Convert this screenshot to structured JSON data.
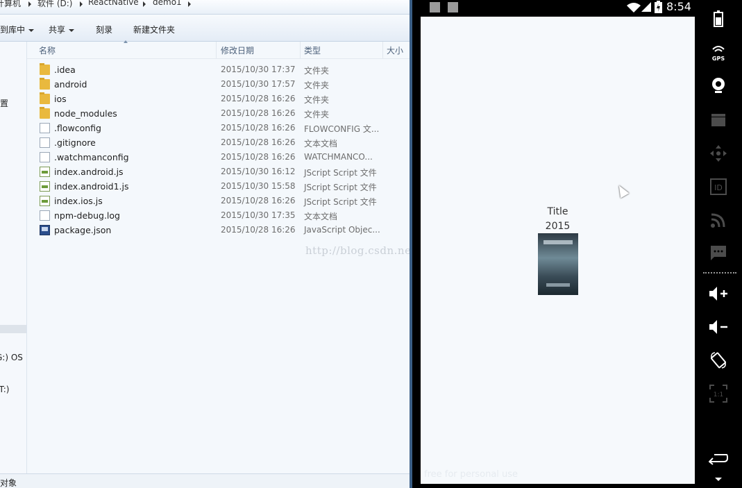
{
  "explorer": {
    "breadcrumb": [
      "计算机",
      "软件 (D:)",
      "ReactNative",
      "demo1"
    ],
    "toolbar": [
      {
        "label": "包含到库中",
        "dropdown": true
      },
      {
        "label": "共享",
        "dropdown": true
      },
      {
        "label": "刻录",
        "dropdown": false
      },
      {
        "label": "新建文件夹",
        "dropdown": false
      }
    ],
    "columns": {
      "name": "名称",
      "date": "修改日期",
      "type": "类型",
      "size": "大小"
    },
    "files": [
      {
        "name": ".idea",
        "date": "2015/10/30 17:37",
        "type": "文件夹",
        "icon": "folder"
      },
      {
        "name": "android",
        "date": "2015/10/30 17:57",
        "type": "文件夹",
        "icon": "folder"
      },
      {
        "name": "ios",
        "date": "2015/10/28 16:26",
        "type": "文件夹",
        "icon": "folder"
      },
      {
        "name": "node_modules",
        "date": "2015/10/28 16:26",
        "type": "文件夹",
        "icon": "folder"
      },
      {
        "name": ".flowconfig",
        "date": "2015/10/28 16:26",
        "type": "FLOWCONFIG 文...",
        "icon": "doc"
      },
      {
        "name": ".gitignore",
        "date": "2015/10/28 16:26",
        "type": "文本文档",
        "icon": "doc"
      },
      {
        "name": ".watchmanconfig",
        "date": "2015/10/28 16:26",
        "type": "WATCHMANCO...",
        "icon": "doc"
      },
      {
        "name": "index.android.js",
        "date": "2015/10/30 16:12",
        "type": "JScript Script 文件",
        "icon": "js"
      },
      {
        "name": "index.android1.js",
        "date": "2015/10/30 15:58",
        "type": "JScript Script 文件",
        "icon": "js"
      },
      {
        "name": "index.ios.js",
        "date": "2015/10/28 16:26",
        "type": "JScript Script 文件",
        "icon": "js"
      },
      {
        "name": "npm-debug.log",
        "date": "2015/10/30 17:35",
        "type": "文本文档",
        "icon": "doc"
      },
      {
        "name": "package.json",
        "date": "2015/10/28 16:26",
        "type": "JavaScript Objec...",
        "icon": "json"
      }
    ],
    "nav_items": [
      "设置",
      "G:) OS",
      "(T:)"
    ],
    "watermark": "http://blog.csdn.net/",
    "status_text": "对象"
  },
  "emulator": {
    "clock": "8:54",
    "app": {
      "title": "Title",
      "year": "2015"
    },
    "watermark": "free for personal use",
    "sidebar_icons": [
      "battery-icon",
      "gps-icon",
      "camera-icon",
      "video-icon",
      "dpad-icon",
      "id-icon",
      "rss-icon",
      "sms-icon",
      "volume-up-icon",
      "volume-down-icon",
      "rotate-icon",
      "scale-icon",
      "back-icon",
      "more-icon"
    ],
    "gps_label": "GPS",
    "id_label": "ID",
    "scale_label": "1:1"
  }
}
